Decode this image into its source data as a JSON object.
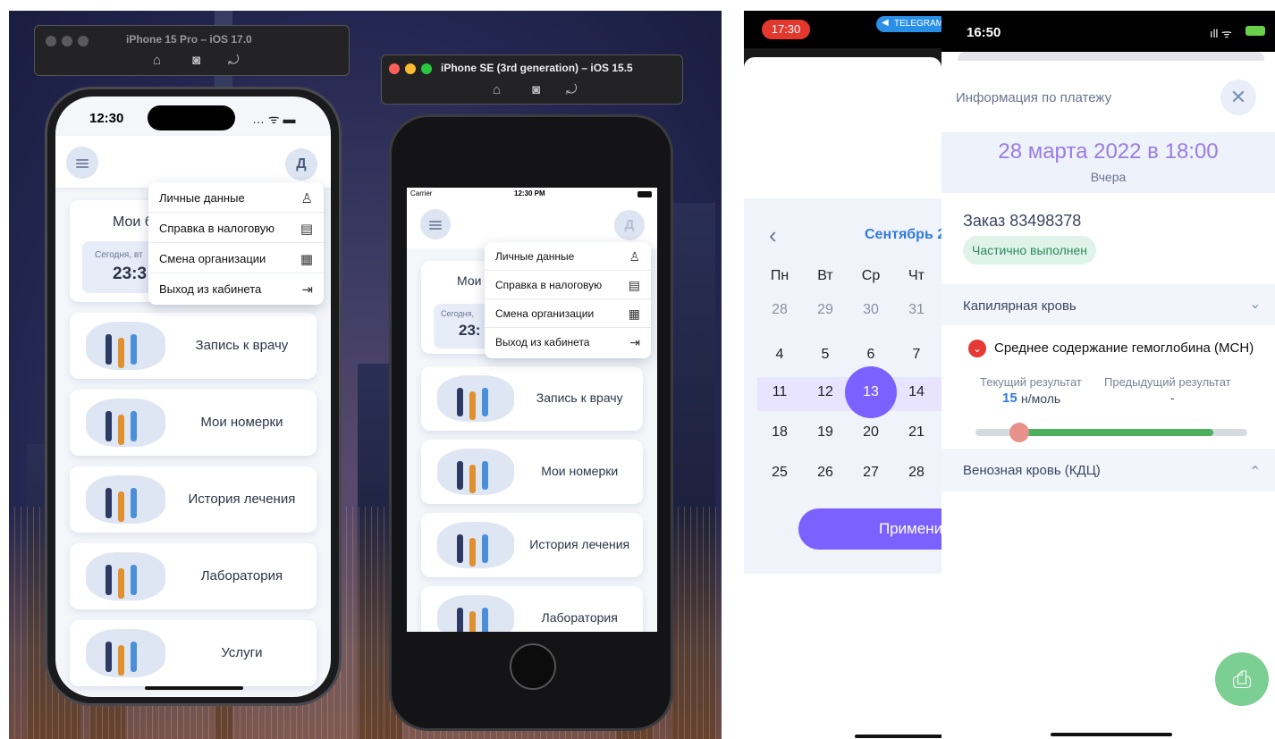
{
  "sim15": {
    "title": "iPhone 15 Pro – iOS 17.0",
    "time": "12:30",
    "avatar": "Д",
    "menu": [
      {
        "label": "Личные данные",
        "icon": "person-icon",
        "glyph": "♙"
      },
      {
        "label": "Справка в налоговую",
        "icon": "clipboard-icon",
        "glyph": "▤"
      },
      {
        "label": "Смена организации",
        "icon": "building-icon",
        "glyph": "▦"
      },
      {
        "label": "Выход из кабинета",
        "icon": "logout-icon",
        "glyph": "⇥"
      }
    ],
    "card_top": "Мои б",
    "today": "Сегодня, вт",
    "clock": "23:3",
    "cards": [
      "Запись к врачу",
      "Мои номерки",
      "История лечения",
      "Лаборатория",
      "Услуги"
    ]
  },
  "simse": {
    "title": "iPhone SE (3rd generation) – iOS 15.5",
    "carrier": "Carrier",
    "time": "12:30 PM",
    "avatar": "Д",
    "menu": [
      {
        "label": "Личные данные",
        "glyph": "♙"
      },
      {
        "label": "Справка в налоговую",
        "glyph": "▤"
      },
      {
        "label": "Смена организации",
        "glyph": "▦"
      },
      {
        "label": "Выход из кабинета",
        "glyph": "⇥"
      }
    ],
    "card_top": "Мои",
    "today": "Сегодня,",
    "clock": "23:",
    "cards": [
      "Запись к врачу",
      "Мои номерки",
      "История лечения",
      "Лаборатория"
    ]
  },
  "calendar": {
    "time": "17:30",
    "badge": "TELEGRAM",
    "month": "Сентябрь 2",
    "prev": "‹",
    "weekdays": [
      "Пн",
      "Вт",
      "Ср",
      "Чт"
    ],
    "rows": [
      [
        "28",
        "29",
        "30",
        "31"
      ],
      [
        "4",
        "5",
        "6",
        "7"
      ],
      [
        "11",
        "12",
        "13",
        "14"
      ],
      [
        "18",
        "19",
        "20",
        "21"
      ],
      [
        "25",
        "26",
        "27",
        "28"
      ]
    ],
    "selected": "13",
    "apply": "Примени",
    "colors": {
      "accent": "#7b61ff",
      "range": "#e8e4ff",
      "month": "#2f7be0"
    }
  },
  "payment": {
    "time": "16:50",
    "title": "Информация по платежу",
    "date": "28 марта 2022 в 18:00",
    "relative": "Вчера",
    "order": "Заказ 83498378",
    "status": "Частично выполнен",
    "section1": "Капилярная кровь",
    "test": "Среднее содержание гемоглобина (МСН)",
    "cur_label": "Текущий результат",
    "prev_label": "Предыдущий результат",
    "cur_value": "15",
    "cur_unit": "н/моль",
    "prev_value": "-",
    "section2": "Венозная кровь (КДЦ)",
    "slider_fraction": 0.16,
    "colors": {
      "date": "#9b7be6",
      "status_bg": "#dff3ea",
      "status_fg": "#2a8a5d",
      "fab": "#7ccf93",
      "bar": "#4cb05c"
    }
  }
}
